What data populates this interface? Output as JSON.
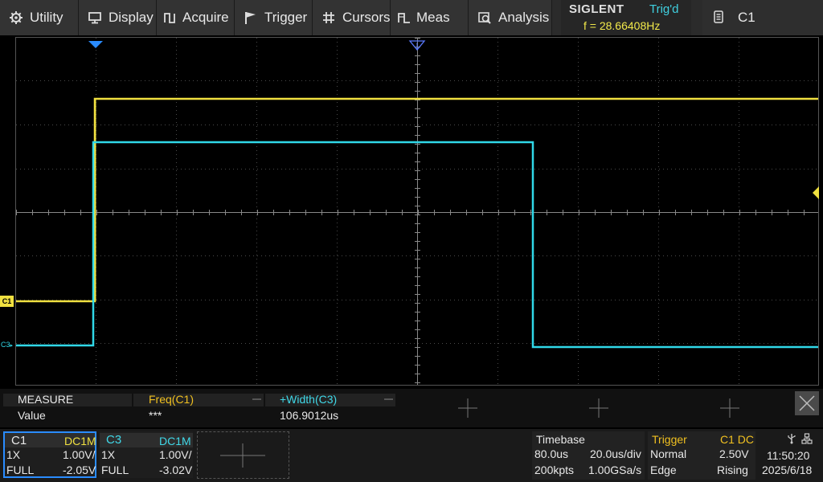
{
  "menu": {
    "items": [
      {
        "label": "Utility",
        "icon": "gear-icon"
      },
      {
        "label": "Display",
        "icon": "monitor-icon"
      },
      {
        "label": "Acquire",
        "icon": "acquire-icon"
      },
      {
        "label": "Trigger",
        "icon": "flag-icon"
      },
      {
        "label": "Cursors",
        "icon": "cursor-grid-icon"
      },
      {
        "label": "Meas",
        "icon": "measure-icon"
      },
      {
        "label": "Analysis",
        "icon": "analysis-icon"
      }
    ]
  },
  "status": {
    "brand": "SIGLENT",
    "trigger_state": "Trig'd",
    "frequency": "f = 28.66408Hz",
    "active_channel": "C1"
  },
  "waveform": {
    "c1_marker": "C1",
    "c3_marker": "C3",
    "c1_color": "#f0e040",
    "c3_color": "#30d8e8"
  },
  "measure": {
    "header_label": "MEASURE",
    "value_label": "Value",
    "items": [
      {
        "name": "Freq(C1)",
        "value": "***",
        "color": "#f0c020"
      },
      {
        "name": "+Width(C3)",
        "value": "106.9012us",
        "color": "#40d8e8"
      }
    ]
  },
  "channels": {
    "c1": {
      "name": "C1",
      "coupling": "DC1M",
      "probe": "1X",
      "scale": "1.00V/",
      "bw": "FULL",
      "offset": "-2.05V"
    },
    "c3": {
      "name": "C3",
      "coupling": "DC1M",
      "probe": "1X",
      "scale": "1.00V/",
      "bw": "FULL",
      "offset": "-3.02V"
    }
  },
  "timebase": {
    "title": "Timebase",
    "delay": "80.0us",
    "scale": "20.0us/div",
    "memory": "200kpts",
    "sample_rate": "1.00GSa/s"
  },
  "trigger": {
    "title": "Trigger",
    "source": "C1 DC",
    "mode": "Normal",
    "level": "2.50V",
    "type": "Edge",
    "slope": "Rising"
  },
  "clock": {
    "time": "11:50:20",
    "date": "2025/6/18"
  }
}
